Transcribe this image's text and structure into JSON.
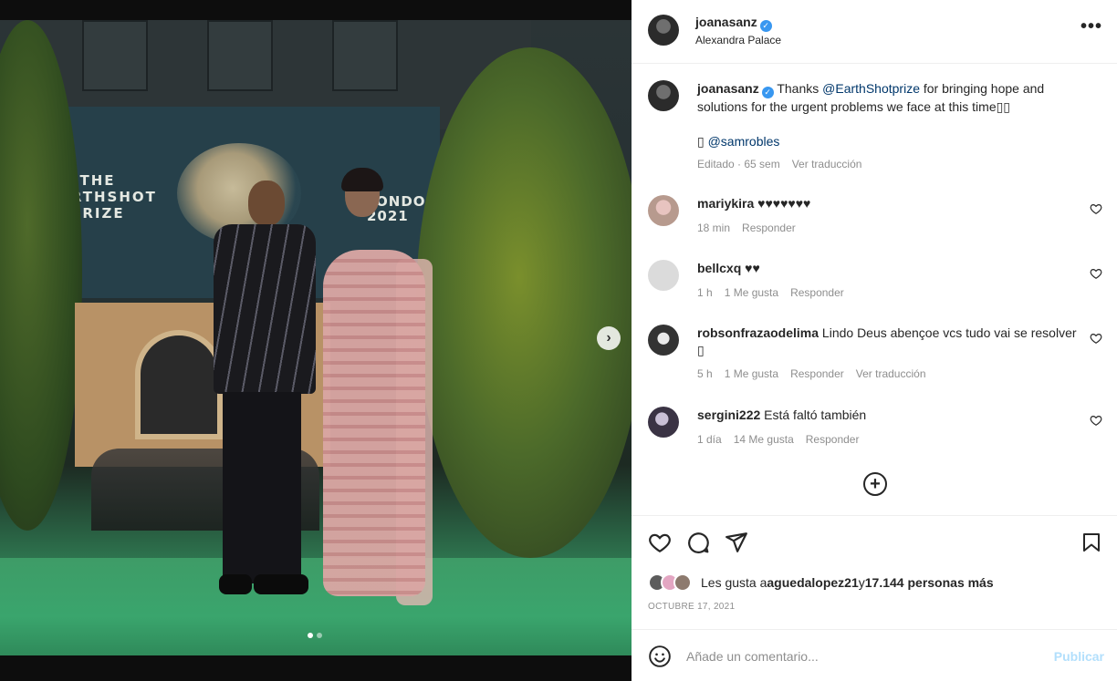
{
  "post": {
    "brand_banner": {
      "title": "THE\nEARTHSHOT\nPRIZE",
      "location_text": "LONDON\n2021"
    }
  },
  "header": {
    "username": "joanasanz",
    "verified": true,
    "location": "Alexandra Palace",
    "more_icon": "•••"
  },
  "caption": {
    "username": "joanasanz",
    "text_before_mention": "Thanks ",
    "mention": "@EarthShotprize",
    "text_after_mention": " for bringing hope and solutions for the urgent problems we face at this time▯▯",
    "credit_prefix": "▯ ",
    "credit_mention": "@samrobles",
    "edited": "Editado · 65 sem",
    "see_translation": "Ver traducción"
  },
  "comments": [
    {
      "username": "mariykira",
      "text": " ♥♥♥♥♥♥♥",
      "time": "18 min",
      "likes": "",
      "reply": "Responder",
      "translate": ""
    },
    {
      "username": "bellcxq",
      "text": " ♥♥",
      "time": "1 h",
      "likes": "1 Me gusta",
      "reply": "Responder",
      "translate": ""
    },
    {
      "username": "robsonfrazaodelima",
      "text": " Lindo Deus abençoe vcs tudo vai se resolver ▯",
      "time": "5 h",
      "likes": "1 Me gusta",
      "reply": "Responder",
      "translate": "Ver traducción"
    },
    {
      "username": "sergini222",
      "text": " Está faltó también",
      "time": "1 día",
      "likes": "14 Me gusta",
      "reply": "Responder",
      "translate": ""
    }
  ],
  "actions": {
    "like_icon": "heart-icon",
    "comment_icon": "comment-icon",
    "share_icon": "share-icon",
    "save_icon": "bookmark-icon"
  },
  "likes": {
    "prefix": "Les gusta a ",
    "user": "aguedalopez21",
    "middle": " y ",
    "count": "17.144 personas más"
  },
  "date": "OCTUBRE 17, 2021",
  "compose": {
    "placeholder": "Añade un comentario...",
    "post_label": "Publicar"
  },
  "colors": {
    "link": "#00376b",
    "verified": "#3897f0",
    "muted": "#8e8e8e",
    "post_disabled": "#b2dffc"
  }
}
